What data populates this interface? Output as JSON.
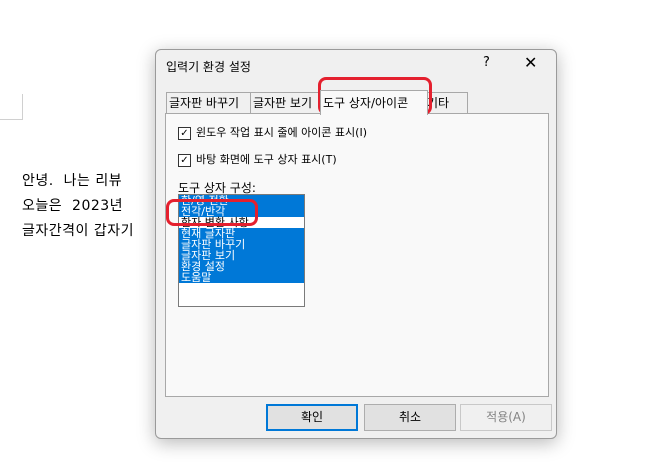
{
  "document": {
    "lines": [
      "안녕.  나는 리뷰",
      "오늘은  2023년",
      "글자간격이 갑자기"
    ]
  },
  "dialog": {
    "title": "입력기 환경 설정",
    "help": "?",
    "close": "✕",
    "tabs": [
      "글자판 바꾸기",
      "글자판 보기",
      "도구 상자/아이콘",
      "기타"
    ],
    "active_tab": "도구 상자/아이콘",
    "checkboxes": [
      {
        "label": "윈도우 작업 표시 줄에 아이콘 표시(I)",
        "checked": true
      },
      {
        "label": "바탕 화면에 도구 상자 표시(T)",
        "checked": true
      }
    ],
    "list_label": "도구 상자 구성:",
    "list_items": [
      {
        "label": "한/영 전환",
        "selected": true
      },
      {
        "label": "전각/반각",
        "selected": true
      },
      {
        "label": "한자 변환 사항",
        "selected": false
      },
      {
        "label": "현재 글자판",
        "selected": true
      },
      {
        "label": "글자판 바꾸기",
        "selected": true
      },
      {
        "label": "글자판 보기",
        "selected": true
      },
      {
        "label": "환경 설정",
        "selected": true
      },
      {
        "label": "도움말",
        "selected": true
      }
    ],
    "buttons": {
      "ok": "확인",
      "cancel": "취소",
      "apply": "적용(A)"
    }
  },
  "colors": {
    "selection": "#0078d7",
    "annotation": "#e4202e"
  }
}
